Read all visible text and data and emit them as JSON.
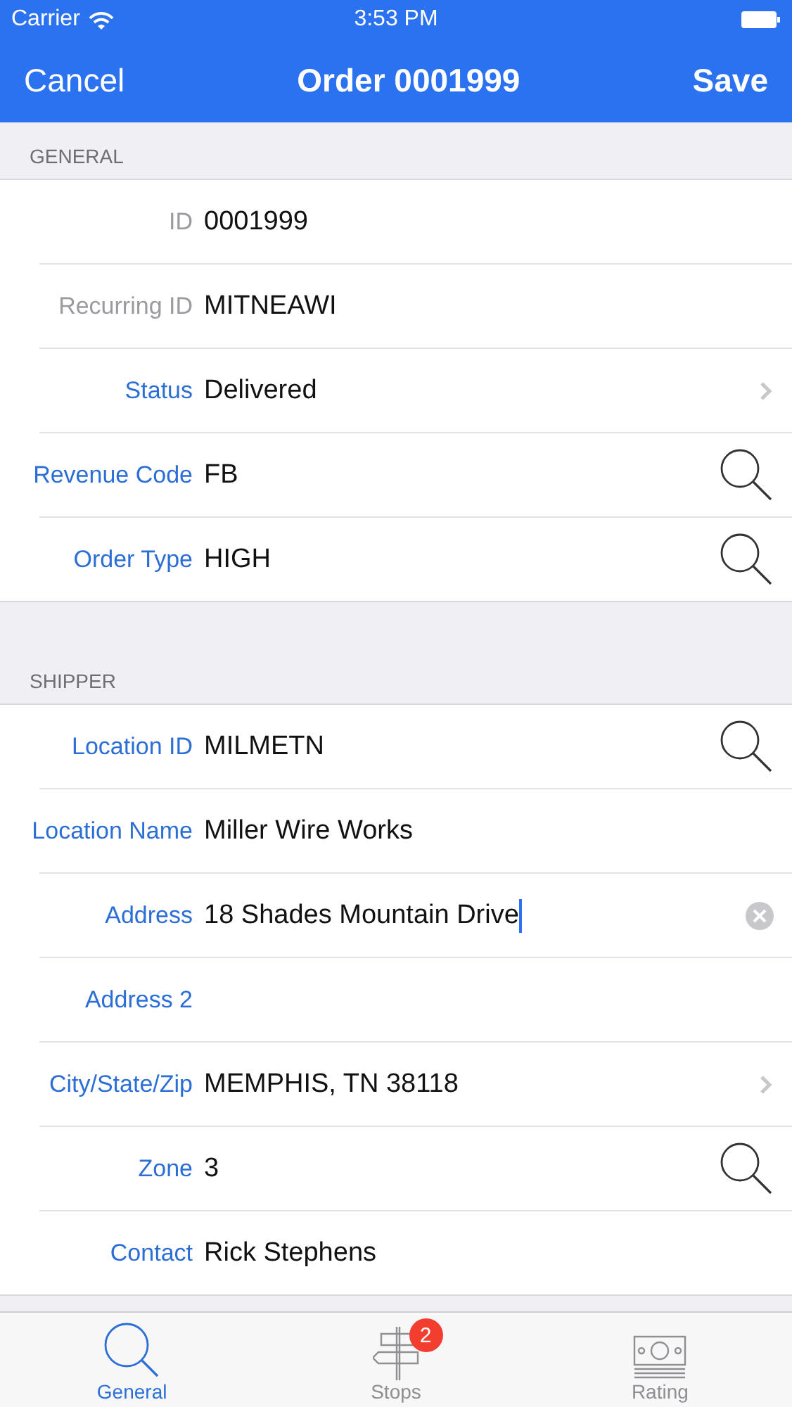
{
  "status_bar": {
    "carrier": "Carrier",
    "time": "3:53 PM"
  },
  "nav": {
    "left": "Cancel",
    "title": "Order 0001999",
    "right": "Save"
  },
  "sections": [
    {
      "header": "GENERAL",
      "rows": [
        {
          "label": "ID",
          "value": "0001999",
          "editable": false,
          "kind": "plain"
        },
        {
          "label": "Recurring ID",
          "value": "MITNEAWI",
          "editable": false,
          "kind": "plain"
        },
        {
          "label": "Status",
          "value": "Delivered",
          "editable": true,
          "kind": "disclosure"
        },
        {
          "label": "Revenue Code",
          "value": "FB",
          "editable": true,
          "kind": "lookup"
        },
        {
          "label": "Order Type",
          "value": "HIGH",
          "editable": true,
          "kind": "lookup"
        }
      ]
    },
    {
      "header": "SHIPPER",
      "rows": [
        {
          "label": "Location ID",
          "value": "MILMETN",
          "editable": true,
          "kind": "lookup"
        },
        {
          "label": "Location Name",
          "value": "Miller Wire Works",
          "editable": true,
          "kind": "plain"
        },
        {
          "label": "Address",
          "value": "18 Shades Mountain Drive",
          "editable": true,
          "kind": "editing"
        },
        {
          "label": "Address 2",
          "editable": true,
          "kind": "plain"
        },
        {
          "label": "City/State/Zip",
          "value": "MEMPHIS, TN 38118",
          "editable": true,
          "kind": "disclosure"
        },
        {
          "label": "Zone",
          "value": "3",
          "editable": true,
          "kind": "lookup"
        },
        {
          "label": "Contact",
          "value": "Rick Stephens",
          "editable": true,
          "kind": "plain"
        }
      ]
    }
  ],
  "tabs": [
    {
      "label": "General",
      "kind": "search",
      "selected": true
    },
    {
      "label": "Stops",
      "kind": "signpost",
      "selected": false,
      "badge": "2"
    },
    {
      "label": "Rating",
      "kind": "money",
      "selected": false
    }
  ]
}
